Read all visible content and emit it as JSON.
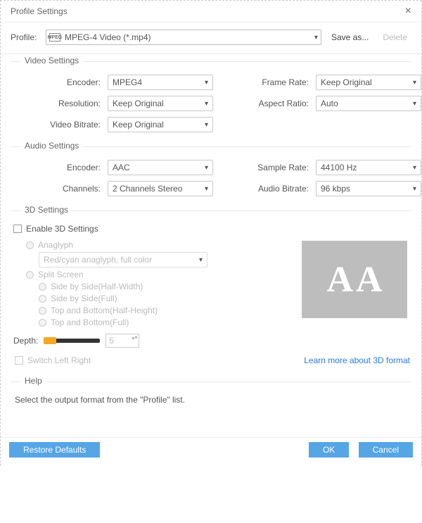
{
  "dialog": {
    "title": "Profile Settings"
  },
  "toprow": {
    "label": "Profile:",
    "value": "MPEG-4 Video (*.mp4)",
    "icon_text": "MPEG",
    "save_as": "Save as...",
    "delete": "Delete"
  },
  "video": {
    "title": "Video Settings",
    "encoder_label": "Encoder:",
    "encoder": "MPEG4",
    "resolution_label": "Resolution:",
    "resolution": "Keep Original",
    "bitrate_label": "Video Bitrate:",
    "bitrate": "Keep Original",
    "framerate_label": "Frame Rate:",
    "framerate": "Keep Original",
    "aspect_label": "Aspect Ratio:",
    "aspect": "Auto"
  },
  "audio": {
    "title": "Audio Settings",
    "encoder_label": "Encoder:",
    "encoder": "AAC",
    "channels_label": "Channels:",
    "channels": "2 Channels Stereo",
    "samplerate_label": "Sample Rate:",
    "samplerate": "44100 Hz",
    "bitrate_label": "Audio Bitrate:",
    "bitrate": "96 kbps"
  },
  "threeD": {
    "title": "3D Settings",
    "enable": "Enable 3D Settings",
    "anaglyph": "Anaglyph",
    "anaglyph_mode": "Red/cyan anaglyph, full color",
    "split": "Split Screen",
    "sbs_half": "Side by Side(Half-Width)",
    "sbs_full": "Side by Side(Full)",
    "tab_half": "Top and Bottom(Half-Height)",
    "tab_full": "Top and Bottom(Full)",
    "depth_label": "Depth:",
    "depth_value": "5",
    "switch_lr": "Switch Left Right",
    "learn_more": "Learn more about 3D format",
    "preview_glyph": "A"
  },
  "help": {
    "title": "Help",
    "text": "Select the output format from the \"Profile\" list."
  },
  "footer": {
    "restore": "Restore Defaults",
    "ok": "OK",
    "cancel": "Cancel"
  }
}
